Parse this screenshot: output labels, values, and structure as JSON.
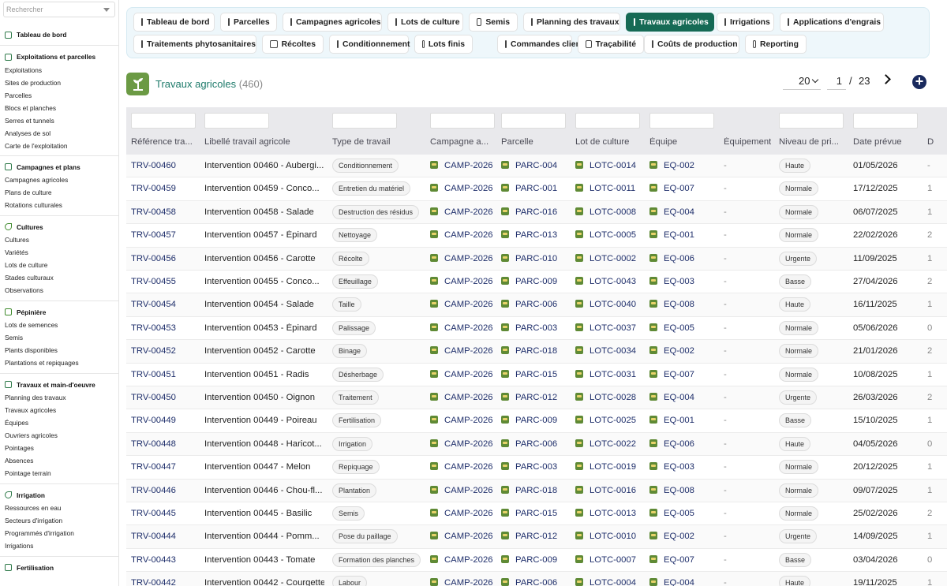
{
  "sidebar": {
    "search_placeholder": "Rechercher",
    "groups": [
      {
        "title": "Tableau de bord",
        "icon": "dashboard-icon",
        "items": []
      },
      {
        "title": "Exploitations et parcelles",
        "icon": "plot-icon",
        "items": [
          "Exploitations",
          "Sites de production",
          "Parcelles",
          "Blocs et planches",
          "Serres et tunnels",
          "Analyses de sol",
          "Carte de l'exploitation"
        ]
      },
      {
        "title": "Campagnes et plans",
        "icon": "calendar-icon",
        "items": [
          "Campagnes agricoles",
          "Plans de culture",
          "Rotations culturales"
        ]
      },
      {
        "title": "Cultures",
        "icon": "leaf-icon",
        "items": [
          "Cultures",
          "Variétés",
          "Lots de culture",
          "Stades culturaux",
          "Observations"
        ]
      },
      {
        "title": "Pépinière",
        "icon": "sprout-icon",
        "items": [
          "Lots de semences",
          "Semis",
          "Plants disponibles",
          "Plantations et repiquages"
        ]
      },
      {
        "title": "Travaux et main-d'oeuvre",
        "icon": "list-icon",
        "items": [
          "Planning des travaux",
          "Travaux agricoles",
          "Équipes",
          "Ouvriers agricoles",
          "Pointages",
          "Absences",
          "Pointage terrain"
        ]
      },
      {
        "title": "Irrigation",
        "icon": "drop-icon",
        "items": [
          "Ressources en eau",
          "Secteurs d'irrigation",
          "Programmés d'irrigation",
          "Irrigations"
        ]
      },
      {
        "title": "Fertilisation",
        "icon": "flask-icon",
        "items": []
      }
    ]
  },
  "tabs": {
    "row1": [
      "Tableau de bord",
      "Parcelles",
      "Campagnes agricoles",
      "Lots de culture",
      "Semis",
      "Planning des travaux",
      "Travaux agricoles",
      "Irrigations",
      "Applications d'engrais"
    ],
    "row2": [
      "Traitements phytosanitaires",
      "Récoltes",
      "Conditionnement",
      "Lots finis",
      "Commandes clients",
      "Traçabilité",
      "Coûts de production",
      "Reporting"
    ],
    "active": "Travaux agricoles"
  },
  "header": {
    "title": "Travaux agricoles",
    "count": "(460)"
  },
  "pager": {
    "page_size": "20",
    "page": "1",
    "sep": "/",
    "total": "23"
  },
  "colors": {
    "accent": "#166a55",
    "link": "#1f2f6b",
    "title": "#1d7a6a"
  },
  "table": {
    "columns": [
      "Référence tra...",
      "Libellé travail agricole",
      "Type de travail",
      "Campagne a...",
      "Parcelle",
      "Lot de culture",
      "Équipe",
      "Équipement",
      "Niveau de pri...",
      "Date prévue",
      "D"
    ],
    "rows": [
      {
        "ref": "TRV-00460",
        "label": "Intervention 00460 - Aubergi...",
        "type": "Conditionnement",
        "camp": "CAMP-2026",
        "parc": "PARC-004",
        "lot": "LOTC-0014",
        "eq": "EQ-002",
        "equip": "-",
        "prio": "Haute",
        "date": "01/05/2026",
        "d": "-"
      },
      {
        "ref": "TRV-00459",
        "label": "Intervention 00459 - Conco...",
        "type": "Entretien du matériel",
        "camp": "CAMP-2026",
        "parc": "PARC-001",
        "lot": "LOTC-0011",
        "eq": "EQ-007",
        "equip": "-",
        "prio": "Normale",
        "date": "17/12/2025",
        "d": "1"
      },
      {
        "ref": "TRV-00458",
        "label": "Intervention 00458 - Salade",
        "type": "Destruction des résidus",
        "camp": "CAMP-2026",
        "parc": "PARC-016",
        "lot": "LOTC-0008",
        "eq": "EQ-004",
        "equip": "-",
        "prio": "Normale",
        "date": "06/07/2025",
        "d": "1"
      },
      {
        "ref": "TRV-00457",
        "label": "Intervention 00457 - Épinard",
        "type": "Nettoyage",
        "camp": "CAMP-2026",
        "parc": "PARC-013",
        "lot": "LOTC-0005",
        "eq": "EQ-001",
        "equip": "-",
        "prio": "Normale",
        "date": "22/02/2026",
        "d": "2"
      },
      {
        "ref": "TRV-00456",
        "label": "Intervention 00456 - Carotte",
        "type": "Récolte",
        "camp": "CAMP-2026",
        "parc": "PARC-010",
        "lot": "LOTC-0002",
        "eq": "EQ-006",
        "equip": "-",
        "prio": "Urgente",
        "date": "11/09/2025",
        "d": "1"
      },
      {
        "ref": "TRV-00455",
        "label": "Intervention 00455 - Conco...",
        "type": "Effeuillage",
        "camp": "CAMP-2026",
        "parc": "PARC-009",
        "lot": "LOTC-0043",
        "eq": "EQ-003",
        "equip": "-",
        "prio": "Basse",
        "date": "27/04/2026",
        "d": "2"
      },
      {
        "ref": "TRV-00454",
        "label": "Intervention 00454 - Salade",
        "type": "Taille",
        "camp": "CAMP-2026",
        "parc": "PARC-006",
        "lot": "LOTC-0040",
        "eq": "EQ-008",
        "equip": "-",
        "prio": "Haute",
        "date": "16/11/2025",
        "d": "1"
      },
      {
        "ref": "TRV-00453",
        "label": "Intervention 00453 - Épinard",
        "type": "Palissage",
        "camp": "CAMP-2026",
        "parc": "PARC-003",
        "lot": "LOTC-0037",
        "eq": "EQ-005",
        "equip": "-",
        "prio": "Normale",
        "date": "05/06/2026",
        "d": "0"
      },
      {
        "ref": "TRV-00452",
        "label": "Intervention 00452 - Carotte",
        "type": "Binage",
        "camp": "CAMP-2026",
        "parc": "PARC-018",
        "lot": "LOTC-0034",
        "eq": "EQ-002",
        "equip": "-",
        "prio": "Normale",
        "date": "21/01/2026",
        "d": "2"
      },
      {
        "ref": "TRV-00451",
        "label": "Intervention 00451 - Radis",
        "type": "Désherbage",
        "camp": "CAMP-2026",
        "parc": "PARC-015",
        "lot": "LOTC-0031",
        "eq": "EQ-007",
        "equip": "-",
        "prio": "Normale",
        "date": "10/08/2025",
        "d": "1"
      },
      {
        "ref": "TRV-00450",
        "label": "Intervention 00450 - Oignon",
        "type": "Traitement",
        "camp": "CAMP-2026",
        "parc": "PARC-012",
        "lot": "LOTC-0028",
        "eq": "EQ-004",
        "equip": "-",
        "prio": "Urgente",
        "date": "26/03/2026",
        "d": "2"
      },
      {
        "ref": "TRV-00449",
        "label": "Intervention 00449 - Poireau",
        "type": "Fertilisation",
        "camp": "CAMP-2026",
        "parc": "PARC-009",
        "lot": "LOTC-0025",
        "eq": "EQ-001",
        "equip": "-",
        "prio": "Basse",
        "date": "15/10/2025",
        "d": "1"
      },
      {
        "ref": "TRV-00448",
        "label": "Intervention 00448 - Haricot...",
        "type": "Irrigation",
        "camp": "CAMP-2026",
        "parc": "PARC-006",
        "lot": "LOTC-0022",
        "eq": "EQ-006",
        "equip": "-",
        "prio": "Haute",
        "date": "04/05/2026",
        "d": "0"
      },
      {
        "ref": "TRV-00447",
        "label": "Intervention 00447 - Melon",
        "type": "Repiquage",
        "camp": "CAMP-2026",
        "parc": "PARC-003",
        "lot": "LOTC-0019",
        "eq": "EQ-003",
        "equip": "-",
        "prio": "Normale",
        "date": "20/12/2025",
        "d": "1"
      },
      {
        "ref": "TRV-00446",
        "label": "Intervention 00446 - Chou-fl...",
        "type": "Plantation",
        "camp": "CAMP-2026",
        "parc": "PARC-018",
        "lot": "LOTC-0016",
        "eq": "EQ-008",
        "equip": "-",
        "prio": "Normale",
        "date": "09/07/2025",
        "d": "1"
      },
      {
        "ref": "TRV-00445",
        "label": "Intervention 00445 - Basilic",
        "type": "Semis",
        "camp": "CAMP-2026",
        "parc": "PARC-015",
        "lot": "LOTC-0013",
        "eq": "EQ-005",
        "equip": "-",
        "prio": "Normale",
        "date": "25/02/2026",
        "d": "2"
      },
      {
        "ref": "TRV-00444",
        "label": "Intervention 00444 - Pomm...",
        "type": "Pose du paillage",
        "camp": "CAMP-2026",
        "parc": "PARC-012",
        "lot": "LOTC-0010",
        "eq": "EQ-002",
        "equip": "-",
        "prio": "Urgente",
        "date": "14/09/2025",
        "d": "1"
      },
      {
        "ref": "TRV-00443",
        "label": "Intervention 00443 - Tomate",
        "type": "Formation des planches",
        "camp": "CAMP-2026",
        "parc": "PARC-009",
        "lot": "LOTC-0007",
        "eq": "EQ-007",
        "equip": "-",
        "prio": "Basse",
        "date": "03/04/2026",
        "d": "0"
      },
      {
        "ref": "TRV-00442",
        "label": "Intervention 00442 - Courgette",
        "type": "Labour",
        "camp": "CAMP-2026",
        "parc": "PARC-006",
        "lot": "LOTC-0004",
        "eq": "EQ-004",
        "equip": "-",
        "prio": "Haute",
        "date": "19/11/2025",
        "d": "1"
      }
    ]
  }
}
